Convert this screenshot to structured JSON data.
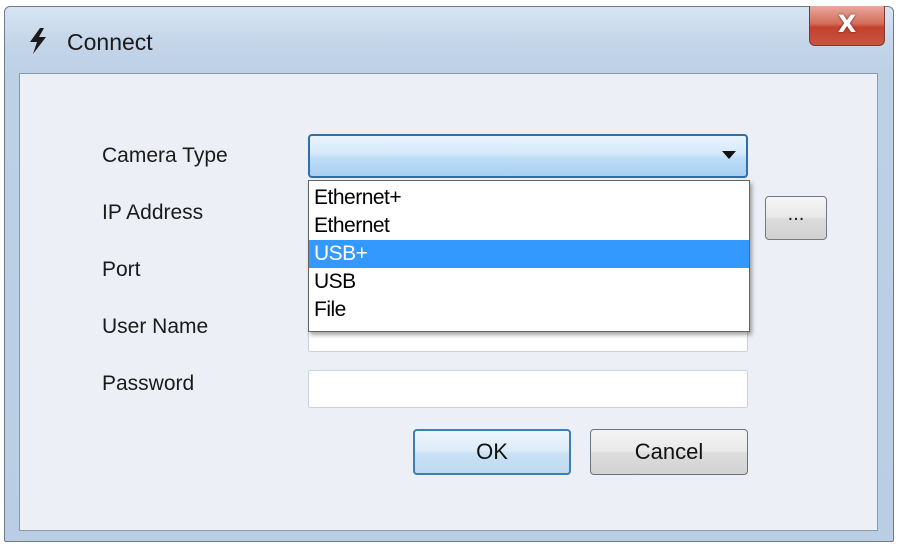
{
  "window": {
    "title": "Connect",
    "close_glyph": "X",
    "title_icon": "lightning-icon"
  },
  "form": {
    "camera_type_label": "Camera Type",
    "ip_address_label": "IP Address",
    "port_label": "Port",
    "user_name_label": "User Name",
    "password_label": "Password",
    "camera_type_value": "",
    "user_name_value": "",
    "password_value": "",
    "browse_label": "..."
  },
  "dropdown": {
    "options": [
      "Ethernet+",
      "Ethernet",
      "USB+",
      "USB",
      "File"
    ],
    "highlighted": "USB+"
  },
  "buttons": {
    "ok_label": "OK",
    "cancel_label": "Cancel"
  },
  "colors": {
    "selection": "#3399ff",
    "close_button": "#c9553f"
  }
}
